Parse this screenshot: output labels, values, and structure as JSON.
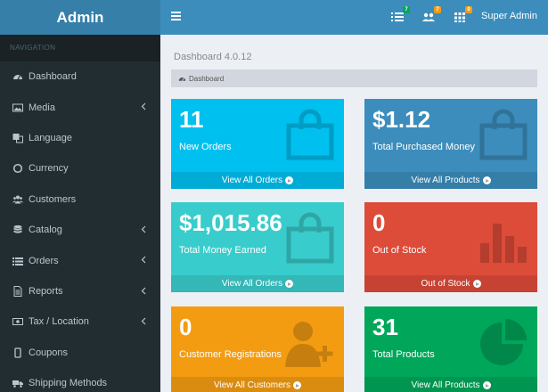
{
  "header": {
    "logo": "Admin",
    "user_name": "Super Admin",
    "badges": [
      {
        "icon": "list-icon",
        "count": "7",
        "color": "#00a65a"
      },
      {
        "icon": "users-icon",
        "count": "7",
        "color": "#f39c12"
      },
      {
        "icon": "grid-icon",
        "count": "0",
        "color": "#f39c12"
      }
    ]
  },
  "sidebar": {
    "header": "NAVIGATION",
    "items": [
      {
        "label": "Dashboard",
        "icon": "dashboard-icon",
        "has_submenu": false
      },
      {
        "label": "Media",
        "icon": "image-icon",
        "has_submenu": true
      },
      {
        "label": "Language",
        "icon": "language-icon",
        "has_submenu": false
      },
      {
        "label": "Currency",
        "icon": "currency-icon",
        "has_submenu": false
      },
      {
        "label": "Customers",
        "icon": "customers-icon",
        "has_submenu": false
      },
      {
        "label": "Catalog",
        "icon": "database-icon",
        "has_submenu": true
      },
      {
        "label": "Orders",
        "icon": "list-icon",
        "has_submenu": true
      },
      {
        "label": "Reports",
        "icon": "file-icon",
        "has_submenu": true
      },
      {
        "label": "Tax / Location",
        "icon": "money-icon",
        "has_submenu": true
      },
      {
        "label": "Coupons",
        "icon": "tablet-icon",
        "has_submenu": false
      },
      {
        "label": "Shipping Methods",
        "icon": "truck-icon",
        "has_submenu": false
      }
    ]
  },
  "main": {
    "title": "Dashboard 4.0.12",
    "breadcrumb": "Dashboard",
    "boxes": [
      {
        "value": "11",
        "label": "New Orders",
        "link": "View All Orders",
        "color": "#00c0ef"
      },
      {
        "value": "$1.12",
        "label": "Total Purchased Money",
        "link": "View All Products",
        "color": "#3c8dbc"
      },
      {
        "value": "$1,015.86",
        "label": "Total Money Earned",
        "link": "View All Orders",
        "color": "#39cccc"
      },
      {
        "value": "0",
        "label": "Out of Stock",
        "link": "Out of Stock",
        "color": "#dd4b39"
      },
      {
        "value": "0",
        "label": "Customer Registrations",
        "link": "View All Customers",
        "color": "#f39c12"
      },
      {
        "value": "31",
        "label": "Total Products",
        "link": "View All Products",
        "color": "#00a65a"
      }
    ]
  }
}
